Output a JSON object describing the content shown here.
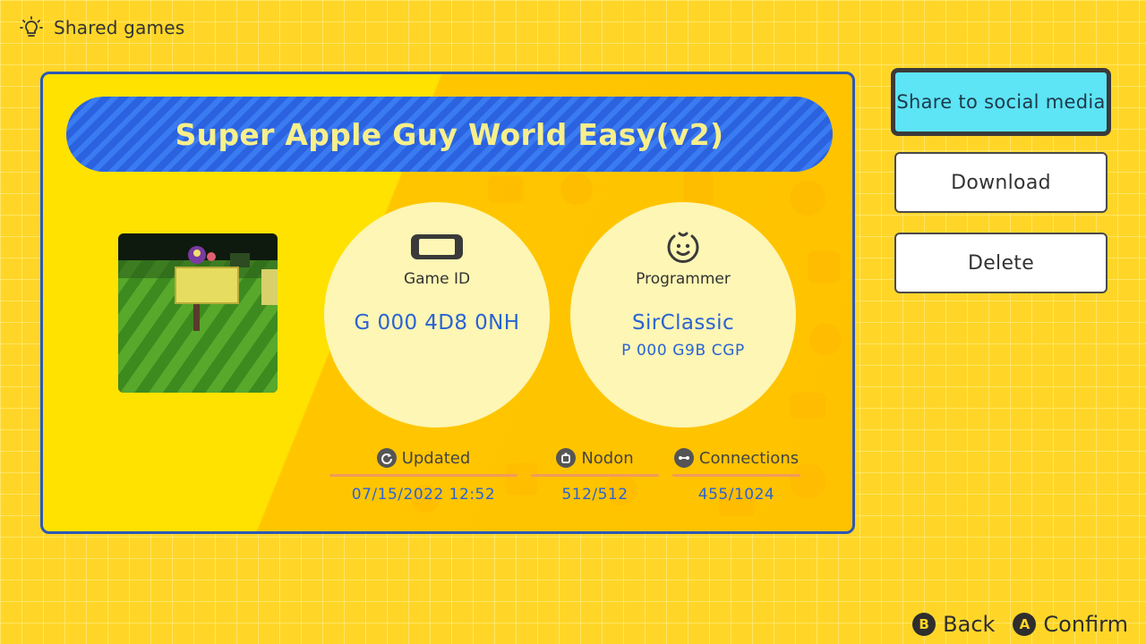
{
  "header": {
    "title": "Shared games",
    "icon": "lightbulb-icon"
  },
  "game": {
    "title": "Super Apple Guy World Easy(v2)",
    "game_id_label": "Game ID",
    "game_id": "G 000 4D8 0NH",
    "programmer_label": "Programmer",
    "programmer_name": "SirClassic",
    "programmer_id": "P 000 G9B CGP"
  },
  "stats": {
    "updated_label": "Updated",
    "updated_value": "07/15/2022 12:52",
    "nodon_label": "Nodon",
    "nodon_value": "512/512",
    "connections_label": "Connections",
    "connections_value": "455/1024"
  },
  "actions": {
    "share": "Share to social media",
    "download": "Download",
    "delete": "Delete"
  },
  "hints": [
    {
      "key": "B",
      "label": "Back"
    },
    {
      "key": "A",
      "label": "Confirm"
    }
  ],
  "colors": {
    "background": "#ffd628",
    "card_border": "#2a58b8",
    "banner": "#2a62e0",
    "title_text": "#f7ef8a",
    "value_text": "#2a63d4",
    "selected_button": "#5de4f5"
  }
}
